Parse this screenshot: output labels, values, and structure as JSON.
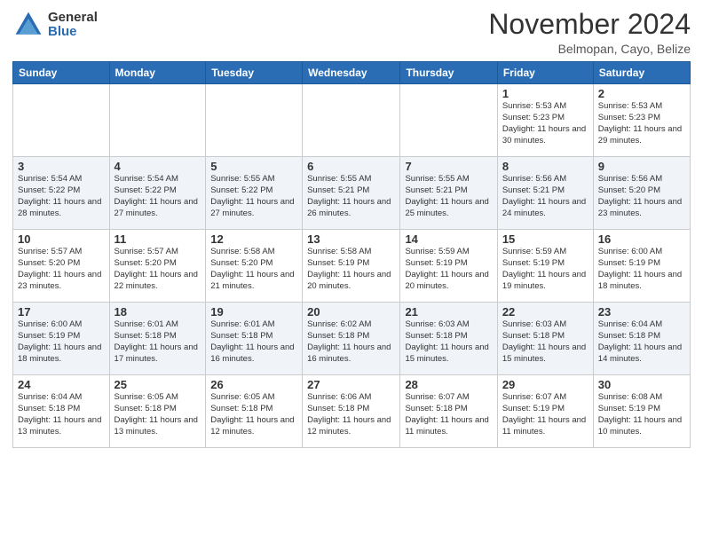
{
  "logo": {
    "general": "General",
    "blue": "Blue"
  },
  "header": {
    "month": "November 2024",
    "location": "Belmopan, Cayo, Belize"
  },
  "weekdays": [
    "Sunday",
    "Monday",
    "Tuesday",
    "Wednesday",
    "Thursday",
    "Friday",
    "Saturday"
  ],
  "weeks": [
    [
      {
        "day": "",
        "detail": ""
      },
      {
        "day": "",
        "detail": ""
      },
      {
        "day": "",
        "detail": ""
      },
      {
        "day": "",
        "detail": ""
      },
      {
        "day": "",
        "detail": ""
      },
      {
        "day": "1",
        "detail": "Sunrise: 5:53 AM\nSunset: 5:23 PM\nDaylight: 11 hours\nand 30 minutes."
      },
      {
        "day": "2",
        "detail": "Sunrise: 5:53 AM\nSunset: 5:23 PM\nDaylight: 11 hours\nand 29 minutes."
      }
    ],
    [
      {
        "day": "3",
        "detail": "Sunrise: 5:54 AM\nSunset: 5:22 PM\nDaylight: 11 hours\nand 28 minutes."
      },
      {
        "day": "4",
        "detail": "Sunrise: 5:54 AM\nSunset: 5:22 PM\nDaylight: 11 hours\nand 27 minutes."
      },
      {
        "day": "5",
        "detail": "Sunrise: 5:55 AM\nSunset: 5:22 PM\nDaylight: 11 hours\nand 27 minutes."
      },
      {
        "day": "6",
        "detail": "Sunrise: 5:55 AM\nSunset: 5:21 PM\nDaylight: 11 hours\nand 26 minutes."
      },
      {
        "day": "7",
        "detail": "Sunrise: 5:55 AM\nSunset: 5:21 PM\nDaylight: 11 hours\nand 25 minutes."
      },
      {
        "day": "8",
        "detail": "Sunrise: 5:56 AM\nSunset: 5:21 PM\nDaylight: 11 hours\nand 24 minutes."
      },
      {
        "day": "9",
        "detail": "Sunrise: 5:56 AM\nSunset: 5:20 PM\nDaylight: 11 hours\nand 23 minutes."
      }
    ],
    [
      {
        "day": "10",
        "detail": "Sunrise: 5:57 AM\nSunset: 5:20 PM\nDaylight: 11 hours\nand 23 minutes."
      },
      {
        "day": "11",
        "detail": "Sunrise: 5:57 AM\nSunset: 5:20 PM\nDaylight: 11 hours\nand 22 minutes."
      },
      {
        "day": "12",
        "detail": "Sunrise: 5:58 AM\nSunset: 5:20 PM\nDaylight: 11 hours\nand 21 minutes."
      },
      {
        "day": "13",
        "detail": "Sunrise: 5:58 AM\nSunset: 5:19 PM\nDaylight: 11 hours\nand 20 minutes."
      },
      {
        "day": "14",
        "detail": "Sunrise: 5:59 AM\nSunset: 5:19 PM\nDaylight: 11 hours\nand 20 minutes."
      },
      {
        "day": "15",
        "detail": "Sunrise: 5:59 AM\nSunset: 5:19 PM\nDaylight: 11 hours\nand 19 minutes."
      },
      {
        "day": "16",
        "detail": "Sunrise: 6:00 AM\nSunset: 5:19 PM\nDaylight: 11 hours\nand 18 minutes."
      }
    ],
    [
      {
        "day": "17",
        "detail": "Sunrise: 6:00 AM\nSunset: 5:19 PM\nDaylight: 11 hours\nand 18 minutes."
      },
      {
        "day": "18",
        "detail": "Sunrise: 6:01 AM\nSunset: 5:18 PM\nDaylight: 11 hours\nand 17 minutes."
      },
      {
        "day": "19",
        "detail": "Sunrise: 6:01 AM\nSunset: 5:18 PM\nDaylight: 11 hours\nand 16 minutes."
      },
      {
        "day": "20",
        "detail": "Sunrise: 6:02 AM\nSunset: 5:18 PM\nDaylight: 11 hours\nand 16 minutes."
      },
      {
        "day": "21",
        "detail": "Sunrise: 6:03 AM\nSunset: 5:18 PM\nDaylight: 11 hours\nand 15 minutes."
      },
      {
        "day": "22",
        "detail": "Sunrise: 6:03 AM\nSunset: 5:18 PM\nDaylight: 11 hours\nand 15 minutes."
      },
      {
        "day": "23",
        "detail": "Sunrise: 6:04 AM\nSunset: 5:18 PM\nDaylight: 11 hours\nand 14 minutes."
      }
    ],
    [
      {
        "day": "24",
        "detail": "Sunrise: 6:04 AM\nSunset: 5:18 PM\nDaylight: 11 hours\nand 13 minutes."
      },
      {
        "day": "25",
        "detail": "Sunrise: 6:05 AM\nSunset: 5:18 PM\nDaylight: 11 hours\nand 13 minutes."
      },
      {
        "day": "26",
        "detail": "Sunrise: 6:05 AM\nSunset: 5:18 PM\nDaylight: 11 hours\nand 12 minutes."
      },
      {
        "day": "27",
        "detail": "Sunrise: 6:06 AM\nSunset: 5:18 PM\nDaylight: 11 hours\nand 12 minutes."
      },
      {
        "day": "28",
        "detail": "Sunrise: 6:07 AM\nSunset: 5:18 PM\nDaylight: 11 hours\nand 11 minutes."
      },
      {
        "day": "29",
        "detail": "Sunrise: 6:07 AM\nSunset: 5:19 PM\nDaylight: 11 hours\nand 11 minutes."
      },
      {
        "day": "30",
        "detail": "Sunrise: 6:08 AM\nSunset: 5:19 PM\nDaylight: 11 hours\nand 10 minutes."
      }
    ]
  ]
}
